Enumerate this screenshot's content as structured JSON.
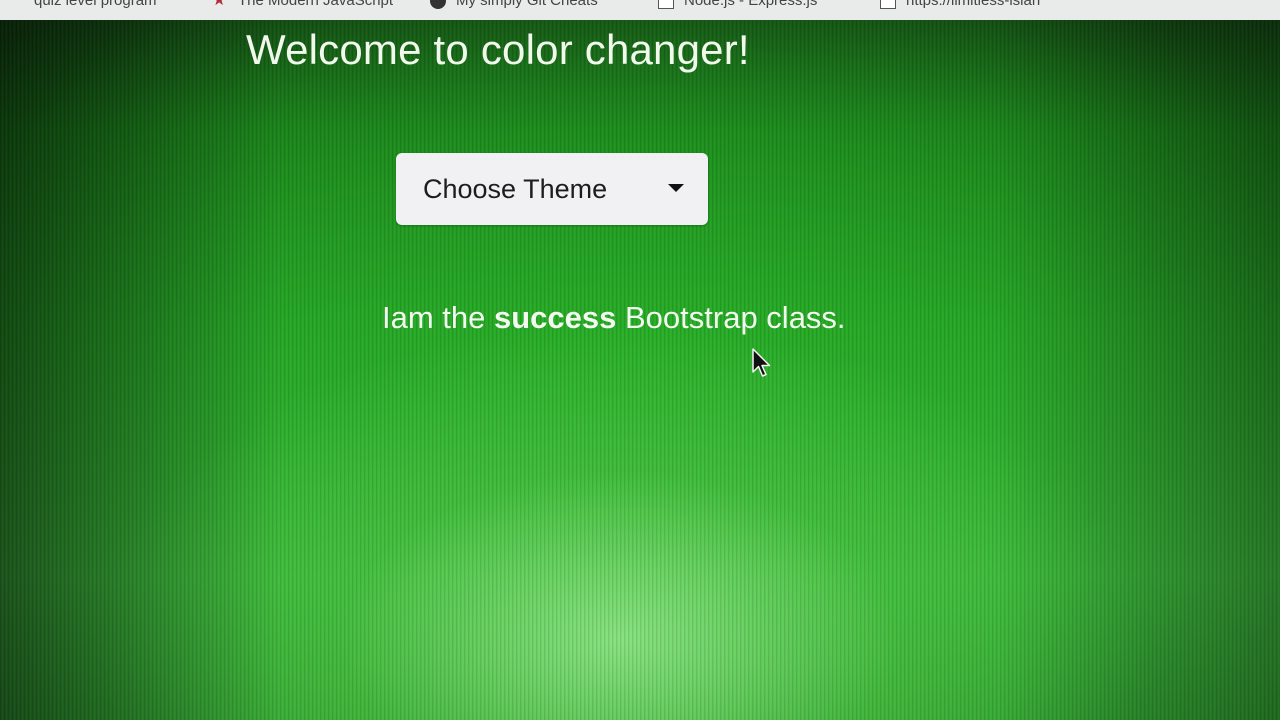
{
  "bookmarks": [
    {
      "label": "quiz level program",
      "icon": "page-icon"
    },
    {
      "label": "The Modern JavaScript",
      "icon": "bookmark-star-icon"
    },
    {
      "label": "My simply Git Cheats",
      "icon": "github-icon"
    },
    {
      "label": "Node.js - Express.js",
      "icon": "document-icon"
    },
    {
      "label": "https://limitless-islan",
      "icon": "page-icon"
    }
  ],
  "page": {
    "title": "Welcome to color changer!",
    "dropdown_label": "Choose Theme",
    "message_prefix": "Iam the ",
    "message_bold": "success",
    "message_suffix": " Bootstrap class."
  },
  "colors": {
    "theme_background": "#28a745",
    "text": "#f3f9ef",
    "dropdown_background": "#f1f1f3"
  }
}
